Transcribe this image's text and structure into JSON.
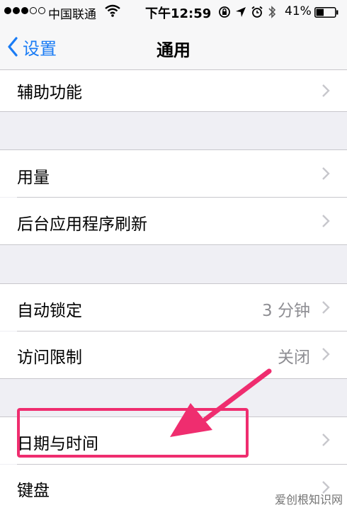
{
  "status_bar": {
    "carrier": "中国联通",
    "time": "下午12:59",
    "battery": "41%",
    "battery_level": 0.41
  },
  "nav": {
    "back_label": "设置",
    "title": "通用"
  },
  "rows": {
    "accessibility": "辅助功能",
    "usage": "用量",
    "background_refresh": "后台应用程序刷新",
    "auto_lock": "自动锁定",
    "auto_lock_value": "3 分钟",
    "restrictions": "访问限制",
    "restrictions_value": "关闭",
    "date_time": "日期与时间",
    "keyboard": "键盘"
  },
  "watermark": "爱创根知识网",
  "colors": {
    "accent": "#1a7cf5",
    "highlight": "#ef2d6f",
    "background": "#efeff4"
  }
}
